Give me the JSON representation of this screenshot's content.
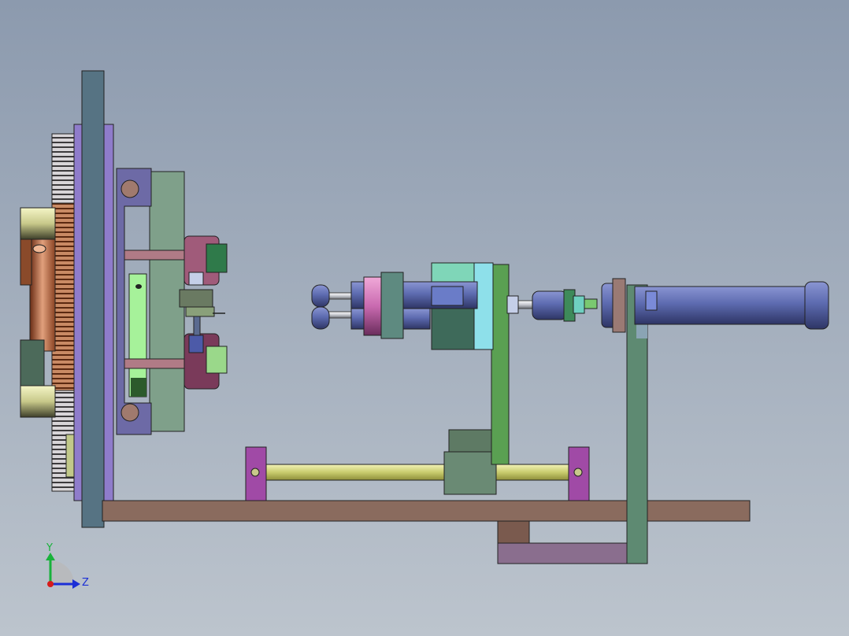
{
  "viewport": {
    "background_top": "#8c9aae",
    "background_bottom": "#bcc4cd"
  },
  "model": {
    "colors": {
      "gear": "#a5542f",
      "gear_light": "#e2ddd8",
      "plate_blue": "#567383",
      "plate_violet": "#8f7ccb",
      "bracket_green": "#7fa08a",
      "slot_green": "#a6f29a",
      "cylinder_blue": "#5d6bb0",
      "pink_nut": "#c96ab0",
      "base_brown": "#8a6b5e",
      "rail_yellow": "#d6d888",
      "support_purple": "#a04aa6",
      "post_green": "#4c8a55"
    }
  },
  "triad": {
    "y_label": "Y",
    "z_label": "Z",
    "y_color": "#19b23b",
    "z_color": "#1b2fd6",
    "x_color": "#d61b1b"
  }
}
